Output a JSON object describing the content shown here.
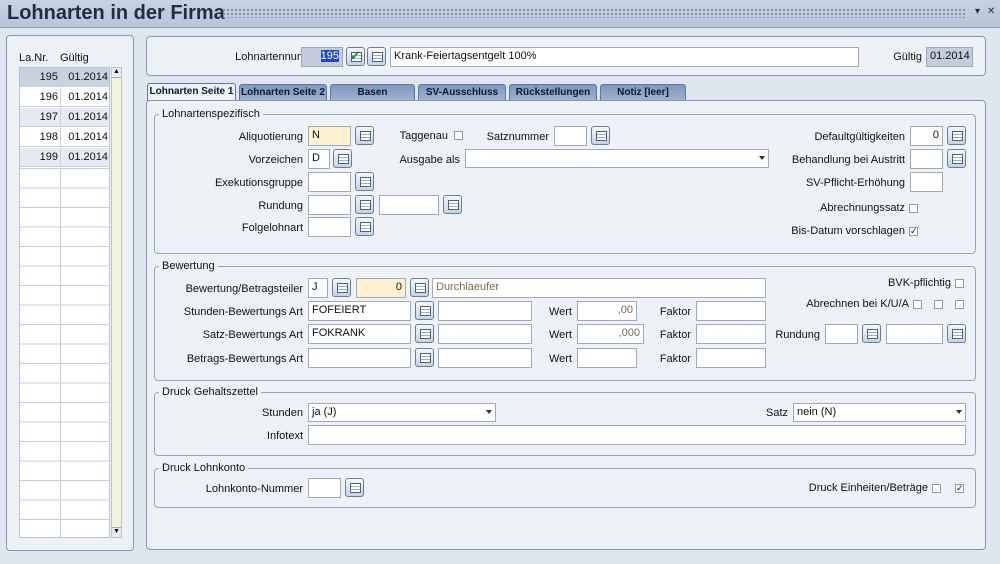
{
  "window": {
    "title": "Lohnarten in der Firma"
  },
  "list": {
    "col_nr": "La.Nr.",
    "col_gueltig": "Gültig",
    "rows": [
      {
        "nr": "195",
        "gueltig": "01.2014"
      },
      {
        "nr": "196",
        "gueltig": "01.2014"
      },
      {
        "nr": "197",
        "gueltig": "01.2014"
      },
      {
        "nr": "198",
        "gueltig": "01.2014"
      },
      {
        "nr": "199",
        "gueltig": "01.2014"
      }
    ]
  },
  "header": {
    "lohnartennummer_label": "Lohnartennummer",
    "lohnartennummer_value": "195",
    "name_value": "Krank-Feiertagsentgelt 100%",
    "gueltig_label": "Gültig",
    "gueltig_value": "01.2014"
  },
  "tabs": [
    "Lohnarten Seite 1",
    "Lohnarten Seite 2",
    "Basen",
    "SV-Ausschluss",
    "Rückstellungen",
    "Notiz [leer]"
  ],
  "spez": {
    "legend": "Lohnartenspezifisch",
    "aliquotierung_label": "Aliquotierung",
    "aliquotierung_value": "N",
    "vorzeichen_label": "Vorzeichen",
    "vorzeichen_value": "D",
    "exekution_label": "Exekutionsgruppe",
    "rundung_label": "Rundung",
    "folgelohnart_label": "Folgelohnart",
    "taggenau_label": "Taggenau",
    "satznummer_label": "Satznummer",
    "ausgabe_label": "Ausgabe als",
    "default_label": "Defaultgültigkeiten",
    "default_value": "0",
    "austritt_label": "Behandlung bei Austritt",
    "svpflicht_label": "SV-Pflicht-Erhöhung",
    "abrechnungssatz_label": "Abrechnungssatz",
    "bisdatum_label": "Bis-Datum vorschlagen"
  },
  "bewertung": {
    "legend": "Bewertung",
    "betragsteiler_label": "Bewertung/Betragsteiler",
    "betragsteiler_value": "J",
    "betragsteiler_num": "0",
    "betragsteiler_text": "Durchlaeufer",
    "stunden_label": "Stunden-Bewertungs Art",
    "stunden_value": "FOFEIERT",
    "stunden_wert": ",00",
    "satz_label": "Satz-Bewertungs Art",
    "satz_value": "FOKRANK",
    "satz_wert": ",000",
    "betrags_label": "Betrags-Bewertungs Art",
    "wert_label": "Wert",
    "faktor_label": "Faktor",
    "bvk_label": "BVK-pflichtig",
    "kua_label": "Abrechnen bei K/U/A",
    "rundung_label": "Rundung"
  },
  "druckgehalt": {
    "legend": "Druck Gehaltszettel",
    "stunden_label": "Stunden",
    "stunden_value": "ja (J)",
    "satz_label": "Satz",
    "satz_value": "nein (N)",
    "infotext_label": "Infotext"
  },
  "drucklohn": {
    "legend": "Druck Lohnkonto",
    "nummer_label": "Lohnkonto-Nummer",
    "einheiten_label": "Druck Einheiten/Beträge"
  }
}
